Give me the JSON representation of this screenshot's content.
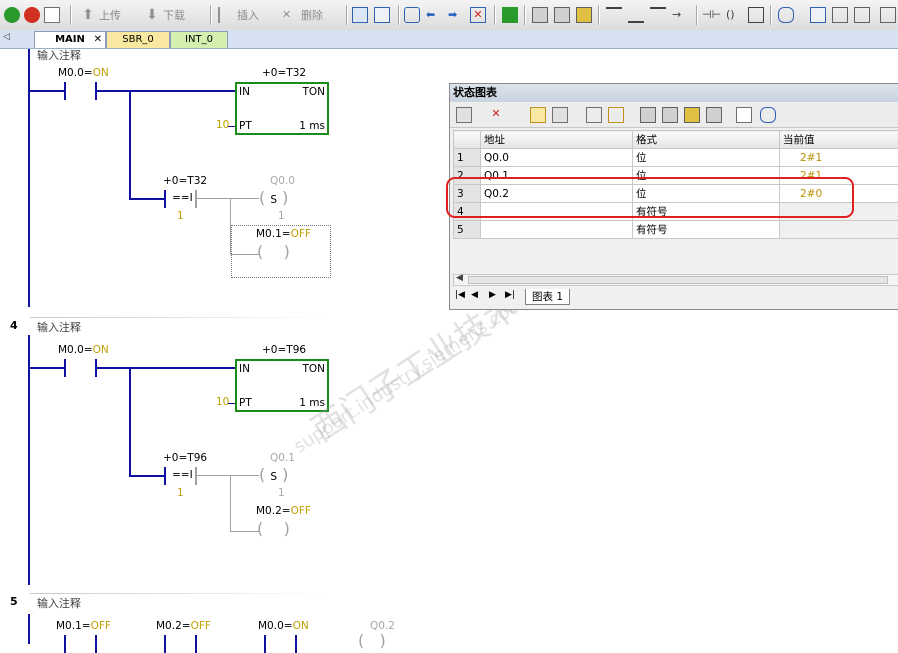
{
  "toolbar": {
    "upload_label": "上传",
    "download_label": "下载",
    "insert_label": "插入",
    "delete_label": "删除"
  },
  "tabs": [
    {
      "label": "MAIN"
    },
    {
      "label": "SBR_0"
    },
    {
      "label": "INT_0"
    }
  ],
  "networks": [
    {
      "number": "",
      "comment": "输入注释",
      "contact1": {
        "addr": "M0.0",
        "state": "ON"
      },
      "timer": {
        "preset_prefix": "+0=",
        "name": "T32",
        "in": "IN",
        "type": "TON",
        "pt_value": "10",
        "pt": "PT",
        "res": "1 ms"
      },
      "compare": {
        "prefix": "+0=",
        "name": "T32",
        "op": "==I",
        "value": "1"
      },
      "coil1": {
        "addr": "Q0.0",
        "type": "S",
        "value": "1"
      },
      "coil2": {
        "addr": "M0.1",
        "state": "OFF"
      }
    },
    {
      "number": "4",
      "comment": "输入注释",
      "contact1": {
        "addr": "M0.0",
        "state": "ON"
      },
      "timer": {
        "preset_prefix": "+0=",
        "name": "T96",
        "in": "IN",
        "type": "TON",
        "pt_value": "10",
        "pt": "PT",
        "res": "1 ms"
      },
      "compare": {
        "prefix": "+0=",
        "name": "T96",
        "op": "==I",
        "value": "1"
      },
      "coil1": {
        "addr": "Q0.1",
        "type": "S",
        "value": "1"
      },
      "coil2": {
        "addr": "M0.2",
        "state": "OFF"
      }
    },
    {
      "number": "5",
      "comment": "输入注释",
      "c1": {
        "addr": "M0.1",
        "state": "OFF"
      },
      "c2": {
        "addr": "M0.2",
        "state": "OFF"
      },
      "c3": {
        "addr": "M0.0",
        "state": "ON"
      },
      "coil": {
        "addr": "Q0.2"
      }
    }
  ],
  "status_chart": {
    "title": "状态图表",
    "headers": {
      "address": "地址",
      "format": "格式",
      "current": "当前值"
    },
    "rows": [
      {
        "n": "1",
        "address": "Q0.0",
        "format": "位",
        "current": "2#1"
      },
      {
        "n": "2",
        "address": "Q0.1",
        "format": "位",
        "current": "2#1"
      },
      {
        "n": "3",
        "address": "Q0.2",
        "format": "位",
        "current": "2#0"
      },
      {
        "n": "4",
        "address": "",
        "format": "有符号",
        "current": ""
      },
      {
        "n": "5",
        "address": "",
        "format": "有符号",
        "current": ""
      }
    ],
    "sheet_tab": "图表 1"
  },
  "watermark": {
    "cn": "西门子工业技术论坛",
    "en": "support.industry.siemens.com/cs"
  },
  "colors": {
    "highlight": "#e02020",
    "box_border": "#1a8c1a",
    "wire": "#1010a0",
    "value_text": "#c0a000"
  }
}
